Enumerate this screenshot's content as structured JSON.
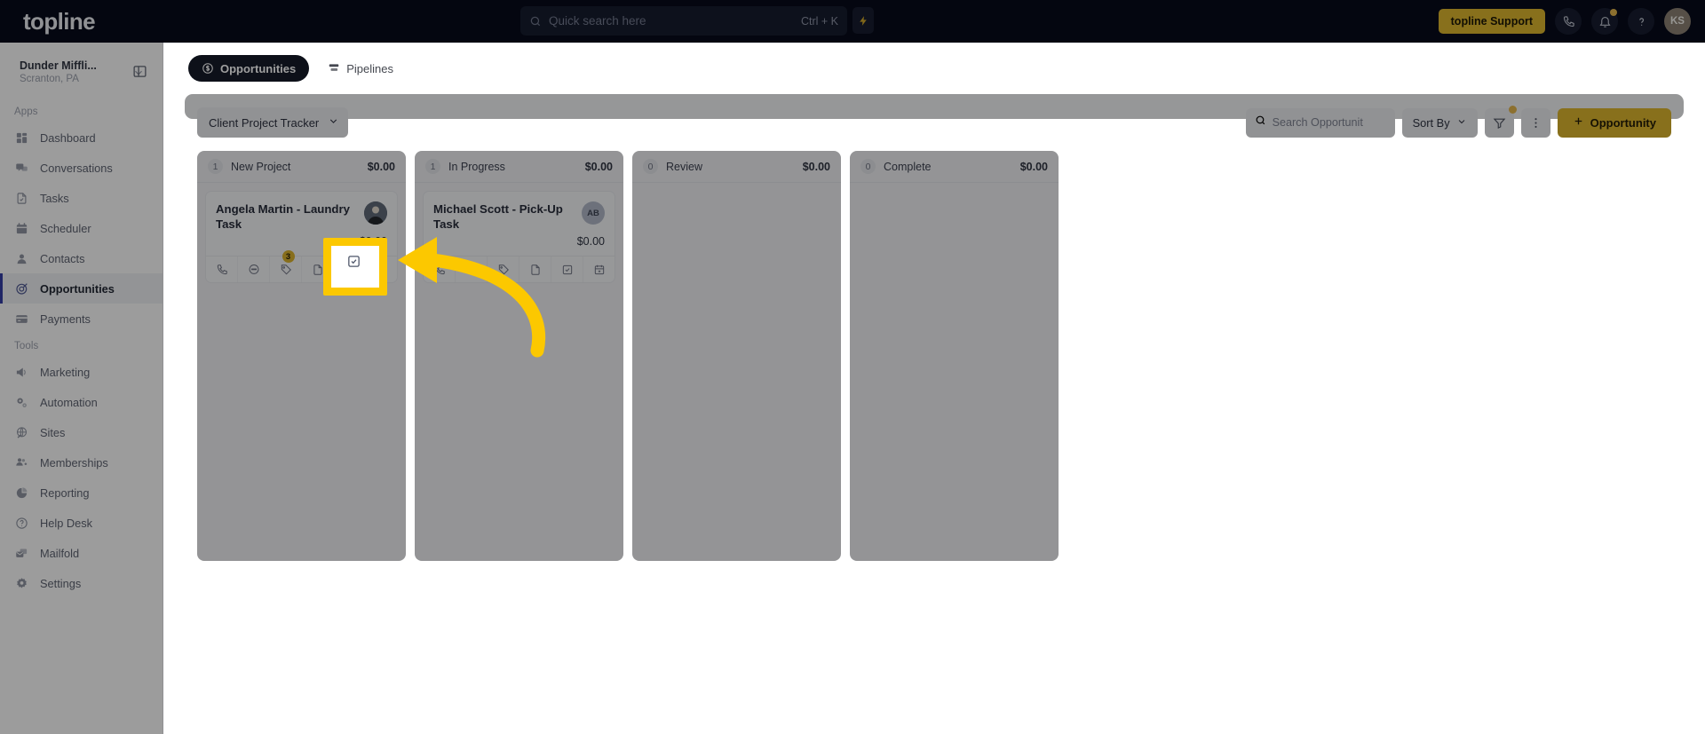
{
  "topbar": {
    "logo": "topline",
    "search": {
      "placeholder": "Quick search here",
      "value": "",
      "shortcut": "Ctrl + K",
      "icon": "search-icon"
    },
    "bolt_icon": "lightning-bolt-icon",
    "support_label": "topline Support",
    "phone_icon": "phone-icon",
    "bell_icon": "bell-icon",
    "help_icon": "question-mark-icon",
    "avatar_initials": "KS",
    "accent": "#e8b500",
    "bg": "#050a1e"
  },
  "sidebar": {
    "org_name": "Dunder Miffli...",
    "org_location": "Scranton, PA",
    "org_chevron_icon": "chevron-down-icon",
    "panel_toggle_icon": "sidebar-toggle-icon",
    "groups": [
      {
        "label": "Apps",
        "items": [
          {
            "label": "Dashboard",
            "icon": "dashboard-icon",
            "active": false
          },
          {
            "label": "Conversations",
            "icon": "chat-bubbles-icon",
            "active": false
          },
          {
            "label": "Tasks",
            "icon": "task-check-icon",
            "active": false
          },
          {
            "label": "Scheduler",
            "icon": "calendar-icon",
            "active": false
          },
          {
            "label": "Contacts",
            "icon": "person-icon",
            "active": false
          },
          {
            "label": "Opportunities",
            "icon": "target-icon",
            "active": true
          },
          {
            "label": "Payments",
            "icon": "credit-card-icon",
            "active": false
          }
        ]
      },
      {
        "label": "Tools",
        "items": [
          {
            "label": "Marketing",
            "icon": "megaphone-icon",
            "active": false
          },
          {
            "label": "Automation",
            "icon": "gears-icon",
            "active": false
          },
          {
            "label": "Sites",
            "icon": "globe-icon",
            "active": false
          },
          {
            "label": "Memberships",
            "icon": "people-plus-icon",
            "active": false
          },
          {
            "label": "Reporting",
            "icon": "pie-chart-icon",
            "active": false
          },
          {
            "label": "Help Desk",
            "icon": "help-circle-icon",
            "active": false
          },
          {
            "label": "Mailfold",
            "icon": "mail-stack-icon",
            "active": false
          },
          {
            "label": "Settings",
            "icon": "gear-icon",
            "active": false
          }
        ]
      }
    ]
  },
  "tabs": [
    {
      "label": "Opportunities",
      "icon": "dollar-circle-icon",
      "active": true
    },
    {
      "label": "Pipelines",
      "icon": "pipeline-icon",
      "active": false
    }
  ],
  "toolbar": {
    "pipeline": "Client Project Tracker",
    "pipeline_chevron_icon": "chevron-down-icon",
    "search_placeholder": "Search Opportunit",
    "search_value": "",
    "search_icon": "search-icon",
    "sort_label": "Sort By",
    "sort_chevron_icon": "chevron-down-icon",
    "filter_icon": "funnel-icon",
    "filter_has_badge": true,
    "more_icon": "kebab-menu-icon",
    "add_label": "Opportunity",
    "add_icon": "plus-icon"
  },
  "board": {
    "columns": [
      {
        "count": "1",
        "title": "New Project",
        "total": "$0.00",
        "cards": [
          {
            "title": "Angela Martin - Laundry Task",
            "amount": "$0.00",
            "avatar_type": "photo",
            "avatar_initials": "",
            "actions": [
              {
                "icon": "phone-call-icon",
                "badge": ""
              },
              {
                "icon": "message-icon",
                "badge": ""
              },
              {
                "icon": "tag-icon",
                "badge": "3"
              },
              {
                "icon": "document-icon",
                "badge": ""
              },
              {
                "icon": "checkbox-icon",
                "badge": ""
              },
              {
                "icon": "calendar-add-icon",
                "badge": ""
              }
            ]
          }
        ]
      },
      {
        "count": "1",
        "title": "In Progress",
        "total": "$0.00",
        "cards": [
          {
            "title": "Michael Scott - Pick-Up Task",
            "amount": "$0.00",
            "avatar_type": "initials",
            "avatar_initials": "AB",
            "actions": [
              {
                "icon": "phone-call-icon",
                "badge": ""
              },
              {
                "icon": "message-icon",
                "badge": ""
              },
              {
                "icon": "tag-icon",
                "badge": ""
              },
              {
                "icon": "document-icon",
                "badge": ""
              },
              {
                "icon": "checkbox-icon",
                "badge": ""
              },
              {
                "icon": "calendar-add-icon",
                "badge": ""
              }
            ]
          }
        ]
      },
      {
        "count": "0",
        "title": "Review",
        "total": "$0.00",
        "cards": []
      },
      {
        "count": "0",
        "title": "Complete",
        "total": "$0.00",
        "cards": []
      }
    ]
  },
  "annotation": {
    "highlight_color": "#fcc800",
    "highlight_target_icon": "checkbox-icon",
    "arrow_icon": "curved-arrow-icon"
  }
}
